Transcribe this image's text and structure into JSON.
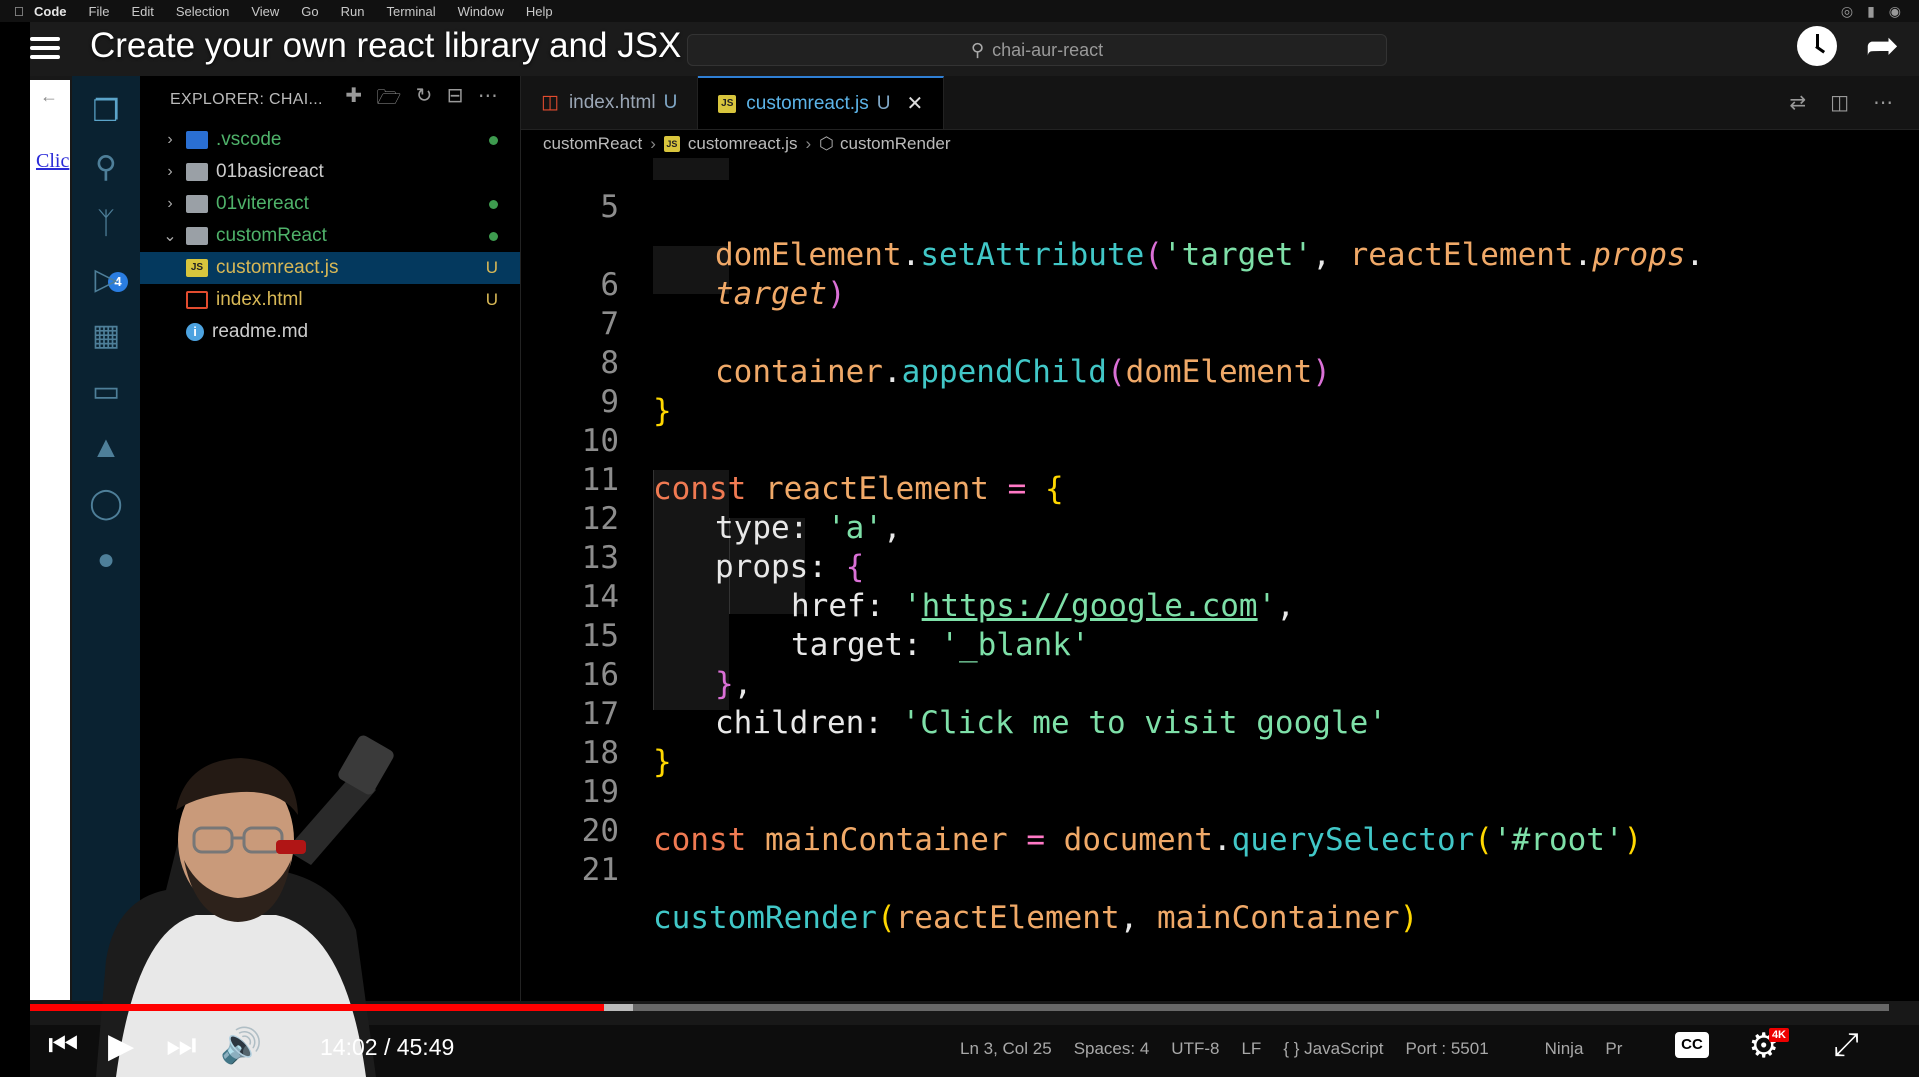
{
  "menubar": {
    "items": [
      "Code",
      "File",
      "Edit",
      "Selection",
      "View",
      "Go",
      "Run",
      "Terminal",
      "Window",
      "Help"
    ]
  },
  "video": {
    "title": "Create your own react library and JSX",
    "time": "14:02 / 45:49",
    "progress_fraction": 0.3085,
    "buffered_fraction": 0.3246
  },
  "window": {
    "search_label": "chai-aur-react"
  },
  "browser": {
    "link_text": "Clic"
  },
  "activity": {
    "badge": "4"
  },
  "explorer": {
    "header": "EXPLORER: CHAI...",
    "items": [
      {
        "label": ".vscode",
        "kind": "folder-special",
        "expanded": false,
        "status": "dot",
        "color": "#5cb85c"
      },
      {
        "label": "01basicreact",
        "kind": "folder",
        "expanded": false,
        "status": ""
      },
      {
        "label": "01vitereact",
        "kind": "folder",
        "expanded": false,
        "status": "dot",
        "color": "#5cb85c"
      },
      {
        "label": "customReact",
        "kind": "folder",
        "expanded": true,
        "status": "dot",
        "color": "#5cb85c"
      },
      {
        "label": "customreact.js",
        "kind": "js",
        "status": "U",
        "selected": true
      },
      {
        "label": "index.html",
        "kind": "html",
        "status": "U"
      },
      {
        "label": "readme.md",
        "kind": "info",
        "status": ""
      }
    ]
  },
  "tabs": [
    {
      "label": "index.html",
      "status": "U",
      "active": false
    },
    {
      "label": "customreact.js",
      "status": "U",
      "active": true
    }
  ],
  "breadcrumb": [
    "customReact",
    "customreact.js",
    "customRender"
  ],
  "code": {
    "line_numbers": [
      "5",
      "",
      "6",
      "7",
      "8",
      "9",
      "10",
      "11",
      "12",
      "13",
      "14",
      "15",
      "16",
      "17",
      "18",
      "19",
      "20",
      "21"
    ]
  },
  "statusbar": {
    "items": [
      "Ln 3, Col 25",
      "Spaces: 4",
      "UTF-8",
      "LF",
      "{ } JavaScript",
      "Port : 5501",
      "Ninja",
      "Pr"
    ]
  },
  "colors": {
    "accent": "#2f7fd5",
    "activity_bg": "#0a2231",
    "progress_red": "#ff0000"
  }
}
